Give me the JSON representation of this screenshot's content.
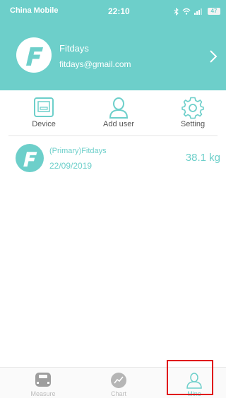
{
  "status_bar": {
    "carrier": "China Mobile",
    "time": "22:10",
    "battery": "47"
  },
  "profile": {
    "name": "Fitdays",
    "email": "fitdays@gmail.com"
  },
  "actions": [
    {
      "label": "Device",
      "icon": "router-icon"
    },
    {
      "label": "Add user",
      "icon": "user-icon"
    },
    {
      "label": "Setting",
      "icon": "gear-icon"
    }
  ],
  "user_entry": {
    "name": "(Primary)Fitdays",
    "date": "22/09/2019",
    "weight": "38.1 kg"
  },
  "tabs": [
    {
      "label": "Measure",
      "icon": "scale-icon"
    },
    {
      "label": "Chart",
      "icon": "chart-icon"
    },
    {
      "label": "Mine",
      "icon": "person-icon"
    }
  ],
  "colors": {
    "accent": "#6dcfca",
    "highlight": "#e0161b"
  }
}
